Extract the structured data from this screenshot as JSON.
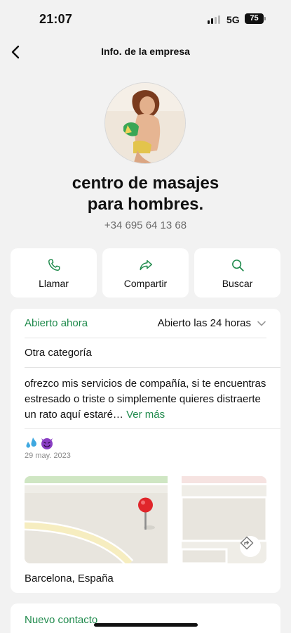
{
  "status_bar": {
    "time": "21:07",
    "network": "5G",
    "battery": "75"
  },
  "nav": {
    "title": "Info. de la empresa"
  },
  "profile": {
    "name_line1": "centro de masajes",
    "name_line2": "para hombres.",
    "phone": "+34 695 64 13 68"
  },
  "actions": [
    {
      "label": "Llamar",
      "icon": "phone-icon"
    },
    {
      "label": "Compartir",
      "icon": "share-icon"
    },
    {
      "label": "Buscar",
      "icon": "search-icon"
    }
  ],
  "hours": {
    "status": "Abierto ahora",
    "text": "Abierto las 24 horas"
  },
  "category": "Otra categoría",
  "description": {
    "text": "ofrezco mis servicios de compañía, si te encuentras estresado o triste o simplemente quieres distraerte un rato aquí estaré… ",
    "see_more": "Ver más"
  },
  "emoji": [
    "sweat-droplets",
    "smiling-imp"
  ],
  "date": "29 may. 2023",
  "map": {
    "pin_icon": "location-pin-icon",
    "directions_icon": "directions-icon"
  },
  "location": "Barcelona, España",
  "bottom": {
    "new_contact": "Nuevo contacto"
  },
  "colors": {
    "accent_green": "#1f8a4c",
    "background": "#f2f2f2",
    "pin_red": "#e0262b"
  }
}
